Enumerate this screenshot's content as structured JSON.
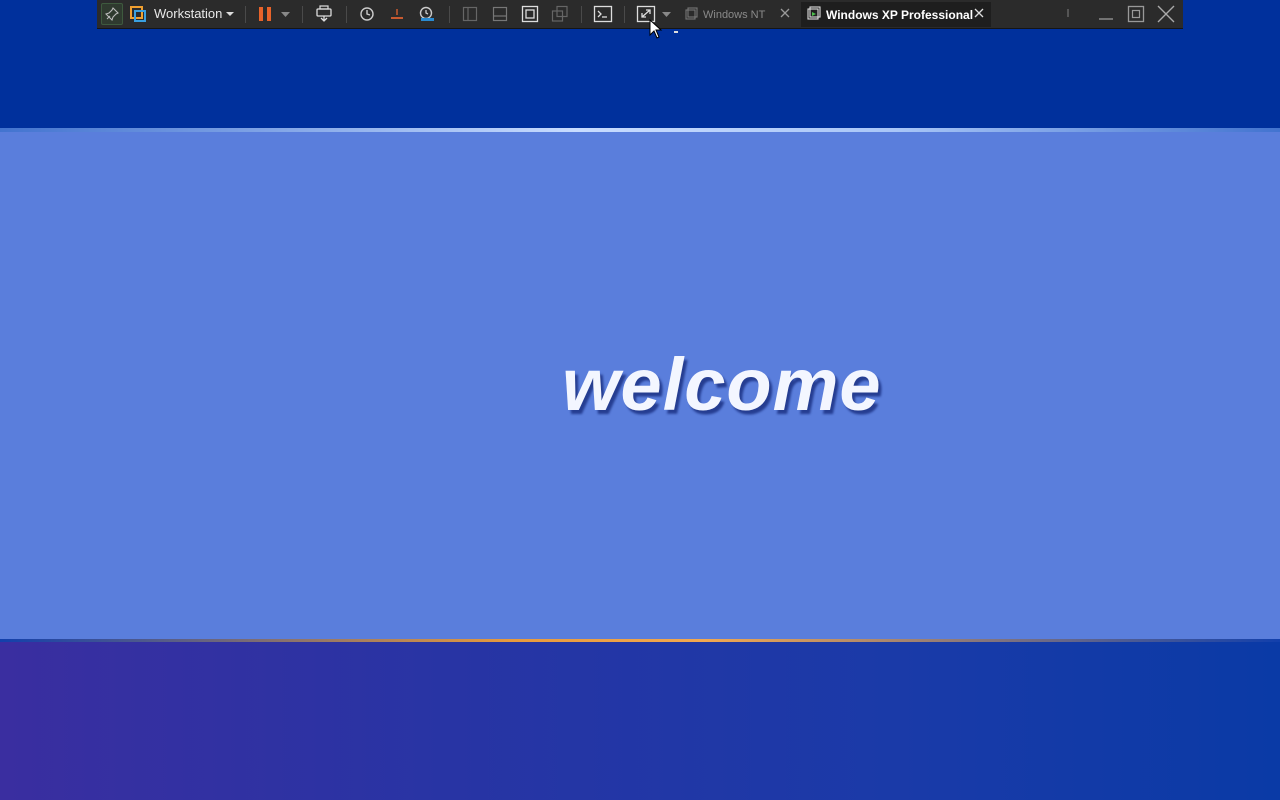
{
  "toolbar": {
    "app_label": "Workstation",
    "icons": {
      "pin": "pin-icon",
      "logo": "vmware-workstation-icon",
      "pause": "pause-icon",
      "send_keys": "ctrl-alt-del-icon",
      "snapshot": "snapshot-icon",
      "revert": "revert-snapshot-icon",
      "snapshot_manager": "snapshot-manager-icon",
      "console": "console-view-icon",
      "stretch": "stretch-guest-icon"
    },
    "accent_pause": "#e8632a",
    "accent_logo": "#f0a030"
  },
  "tabs": [
    {
      "label": "Windows NT",
      "active": false
    },
    {
      "label": "Windows XP Professional",
      "active": true
    }
  ],
  "guest": {
    "welcome_text": "welcome",
    "colors": {
      "top_band": "#00309c",
      "middle_band": "#5a7edc",
      "bottom_band": "#2834a4",
      "accent_line": "#e89a3c"
    }
  }
}
